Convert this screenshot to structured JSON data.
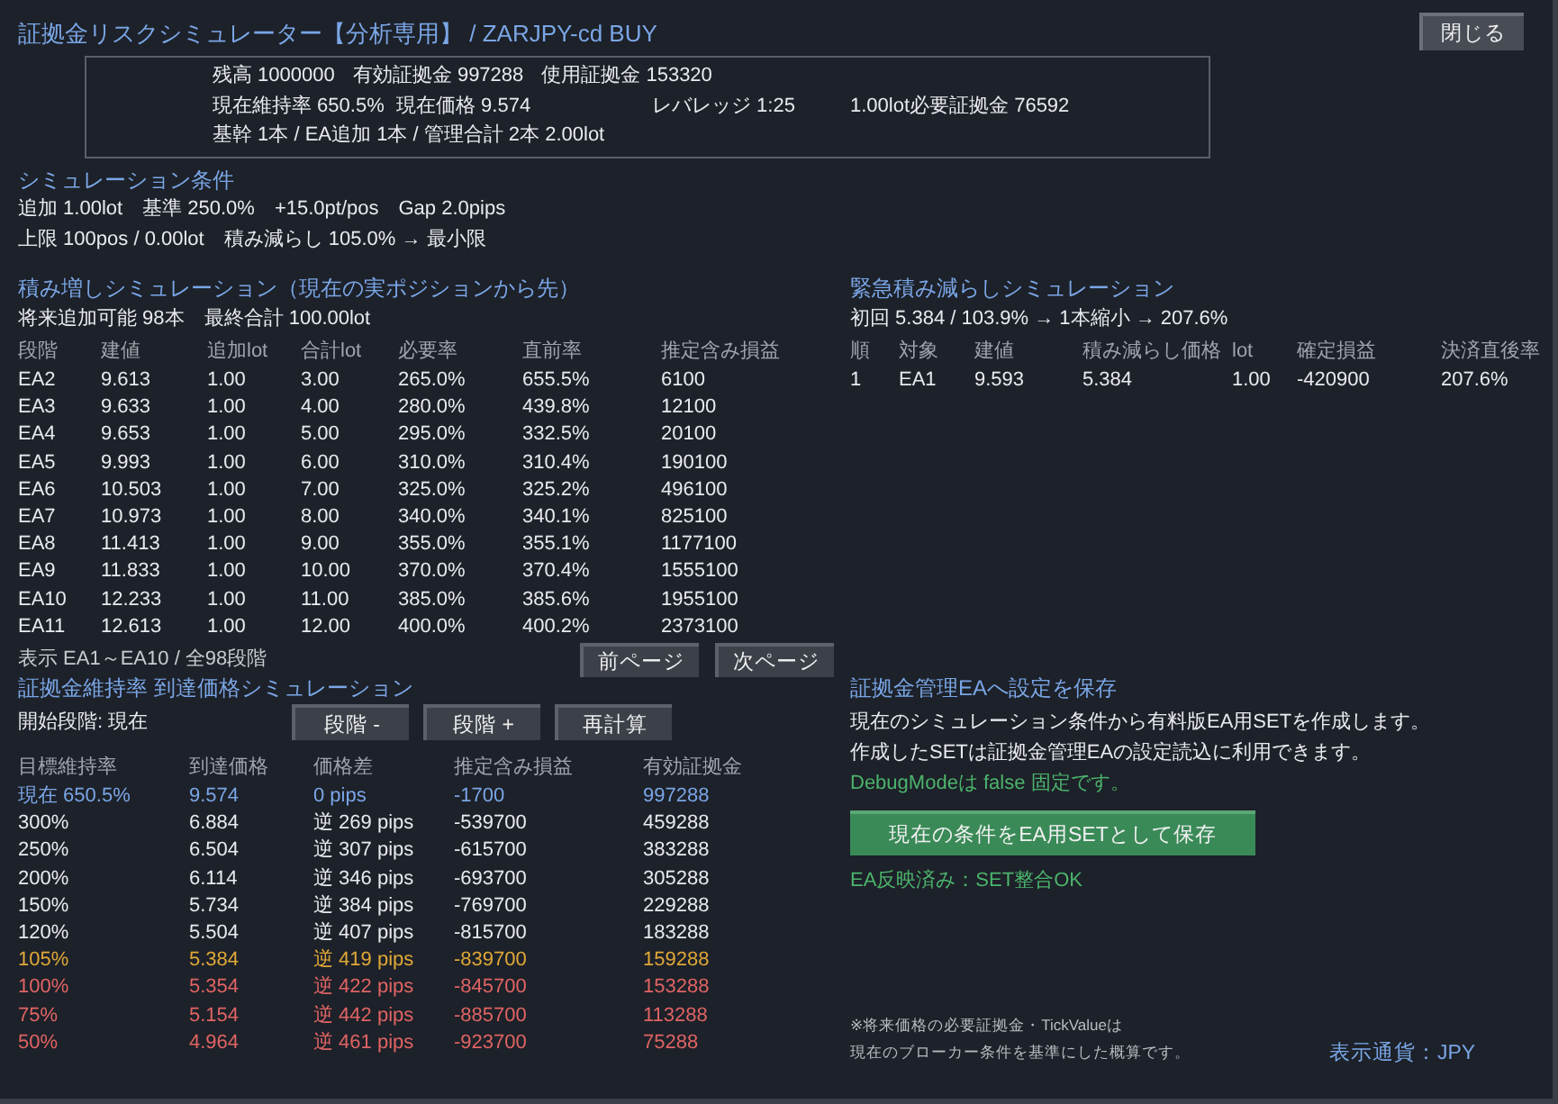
{
  "window": {
    "title": "証拠金リスクシミュレーター【分析専用】 / ZARJPY-cd BUY",
    "close_button": "閉じる"
  },
  "account_info": {
    "lines": [
      [
        "残高 1000000",
        "有効証拠金 997288",
        "使用証拠金 153320"
      ],
      [
        "現在維持率 650.5%",
        "現在価格 9.574",
        "レバレッジ 1:25",
        "1.00lot必要証拠金 76592"
      ],
      [
        "基幹 1本 / EA追加 1本 / 管理合計 2本 2.00lot"
      ]
    ]
  },
  "conditions": {
    "heading": "シミュレーション条件",
    "lines": [
      "追加 1.00lot　基準 250.0%　+15.0pt/pos　Gap 2.0pips",
      "上限 100pos / 0.00lot　積み減らし 105.0% → 最小限"
    ]
  },
  "accumulation": {
    "heading": "積み増しシミュレーション（現在の実ポジションから先）",
    "summary": "将来追加可能 98本　最終合計 100.00lot",
    "columns": [
      "段階",
      "建値",
      "追加lot",
      "合計lot",
      "必要率",
      "直前率",
      "推定含み損益"
    ],
    "rows": [
      [
        "EA2",
        "9.613",
        "1.00",
        "3.00",
        "265.0%",
        "655.5%",
        "6100"
      ],
      [
        "EA3",
        "9.633",
        "1.00",
        "4.00",
        "280.0%",
        "439.8%",
        "12100"
      ],
      [
        "EA4",
        "9.653",
        "1.00",
        "5.00",
        "295.0%",
        "332.5%",
        "20100"
      ],
      [
        "EA5",
        "9.993",
        "1.00",
        "6.00",
        "310.0%",
        "310.4%",
        "190100"
      ],
      [
        "EA6",
        "10.503",
        "1.00",
        "7.00",
        "325.0%",
        "325.2%",
        "496100"
      ],
      [
        "EA7",
        "10.973",
        "1.00",
        "8.00",
        "340.0%",
        "340.1%",
        "825100"
      ],
      [
        "EA8",
        "11.413",
        "1.00",
        "9.00",
        "355.0%",
        "355.1%",
        "1177100"
      ],
      [
        "EA9",
        "11.833",
        "1.00",
        "10.00",
        "370.0%",
        "370.4%",
        "1555100"
      ],
      [
        "EA10",
        "12.233",
        "1.00",
        "11.00",
        "385.0%",
        "385.6%",
        "1955100"
      ],
      [
        "EA11",
        "12.613",
        "1.00",
        "12.00",
        "400.0%",
        "400.2%",
        "2373100"
      ]
    ],
    "page_info": "表示 EA1～EA10 / 全98段階",
    "buttons": [
      "前ページ",
      "次ページ"
    ]
  },
  "emergency": {
    "heading": "緊急積み減らしシミュレーション",
    "summary": "初回 5.384 / 103.9% → 1本縮小 → 207.6%",
    "columns": [
      "順",
      "対象",
      "建値",
      "積み減らし価格",
      "lot",
      "確定損益",
      "決済直後率"
    ],
    "rows": [
      [
        "1",
        "EA1",
        "9.593",
        "5.384",
        "1.00",
        "-420900",
        "207.6%"
      ]
    ]
  },
  "margin_levels": {
    "heading": "証拠金維持率 到達価格シミュレーション",
    "start_label": "開始段階: 現在",
    "buttons": [
      "段階 -",
      "段階 +",
      "再計算"
    ],
    "columns": [
      "目標維持率",
      "到達価格",
      "価格差",
      "推定含み損益",
      "有効証拠金"
    ],
    "rows": [
      {
        "color": "#7aa6e6",
        "cells": [
          "現在 650.5%",
          "9.574",
          "0 pips",
          "-1700",
          "997288"
        ]
      },
      {
        "color": "#e8eaee",
        "cells": [
          "300%",
          "6.884",
          "逆 269 pips",
          "-539700",
          "459288"
        ]
      },
      {
        "color": "#e8eaee",
        "cells": [
          "250%",
          "6.504",
          "逆 307 pips",
          "-615700",
          "383288"
        ]
      },
      {
        "color": "#e8eaee",
        "cells": [
          "200%",
          "6.114",
          "逆 346 pips",
          "-693700",
          "305288"
        ]
      },
      {
        "color": "#e8eaee",
        "cells": [
          "150%",
          "5.734",
          "逆 384 pips",
          "-769700",
          "229288"
        ]
      },
      {
        "color": "#e8eaee",
        "cells": [
          "120%",
          "5.504",
          "逆 407 pips",
          "-815700",
          "183288"
        ]
      },
      {
        "color": "#e0a838",
        "cells": [
          "105%",
          "5.384",
          "逆 419 pips",
          "-839700",
          "159288"
        ]
      },
      {
        "color": "#e06464",
        "cells": [
          "100%",
          "5.354",
          "逆 422 pips",
          "-845700",
          "153288"
        ]
      },
      {
        "color": "#e06464",
        "cells": [
          "75%",
          "5.154",
          "逆 442 pips",
          "-885700",
          "113288"
        ]
      },
      {
        "color": "#e06464",
        "cells": [
          "50%",
          "4.964",
          "逆 461 pips",
          "-923700",
          "75288"
        ]
      }
    ]
  },
  "save_settings": {
    "heading": "証拠金管理EAへ設定を保存",
    "description": [
      "現在のシミュレーション条件から有料版EA用SETを作成します。",
      "作成したSETは証拠金管理EAの設定読込に利用できます。"
    ],
    "debug_note": "DebugModeは false 固定です。",
    "save_button": "現在の条件をEA用SETとして保存",
    "status": "EA反映済み：SET整合OK",
    "footnotes": [
      "※将来価格の必要証拠金・TickValueは",
      "現在のブローカー条件を基準にした概算です。"
    ],
    "currency": "表示通貨：JPY"
  }
}
